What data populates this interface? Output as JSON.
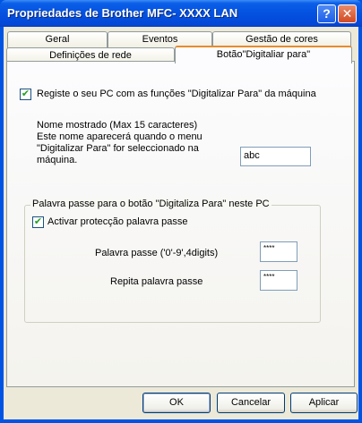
{
  "window": {
    "title": "Propriedades de Brother MFC- XXXX LAN",
    "help_glyph": "?",
    "close_glyph": "✕"
  },
  "tabs_back": [
    "Geral",
    "Eventos",
    "Gestão de cores"
  ],
  "tabs_front": [
    "Definições de rede",
    "Botão\"Digitaliar para\""
  ],
  "active_tab": "Botão\"Digitaliar para\"",
  "register": {
    "checked": true,
    "check_glyph": "✔",
    "label": "Registe o seu PC com as funções \"Digitalizar Para\" da máquina"
  },
  "display_name": {
    "label_lines": [
      "Nome mostrado (Max 15 caracteres)",
      "Este nome aparecerá quando o menu",
      "\"Digitalizar Para\" for seleccionado na",
      "máquina."
    ],
    "value": "abc"
  },
  "password_group": {
    "legend": "Palavra passe para o botão \"Digitaliza Para\" neste PC",
    "activate": {
      "checked": true,
      "check_glyph": "✔",
      "label": "Activar protecção palavra passe"
    },
    "password_label": "Palavra passe ('0'-9',4digits)",
    "password_value": "****",
    "repeat_label": "Repita palavra passe",
    "repeat_value": "****"
  },
  "buttons": {
    "ok": "OK",
    "cancel": "Cancelar",
    "apply": "Aplicar"
  }
}
